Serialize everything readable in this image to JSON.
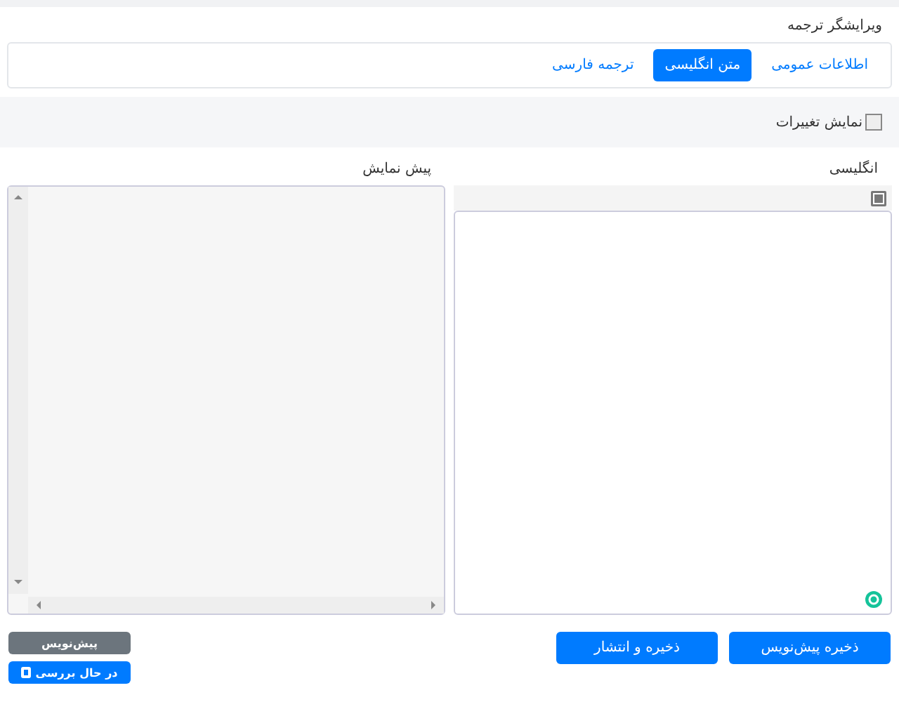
{
  "title": "ویرایشگر ترجمه",
  "tabs": [
    {
      "label": "اطلاعات عمومی",
      "selected": false
    },
    {
      "label": "متن انگلیسی",
      "selected": true
    },
    {
      "label": "ترجمه فارسی",
      "selected": false
    }
  ],
  "show_changes": {
    "label": "نمایش تغییرات",
    "checked": false
  },
  "editor": {
    "label": "انگلیسی"
  },
  "preview": {
    "label": "پیش نمایش"
  },
  "actions": [
    {
      "label": "ذخیره پیش‌نویس"
    },
    {
      "label": "ذخیره و انتشار"
    }
  ],
  "status_badges": [
    {
      "label": "پیش‌نویس",
      "kind": "muted"
    },
    {
      "label": "در حال بررسی",
      "kind": "active"
    }
  ]
}
